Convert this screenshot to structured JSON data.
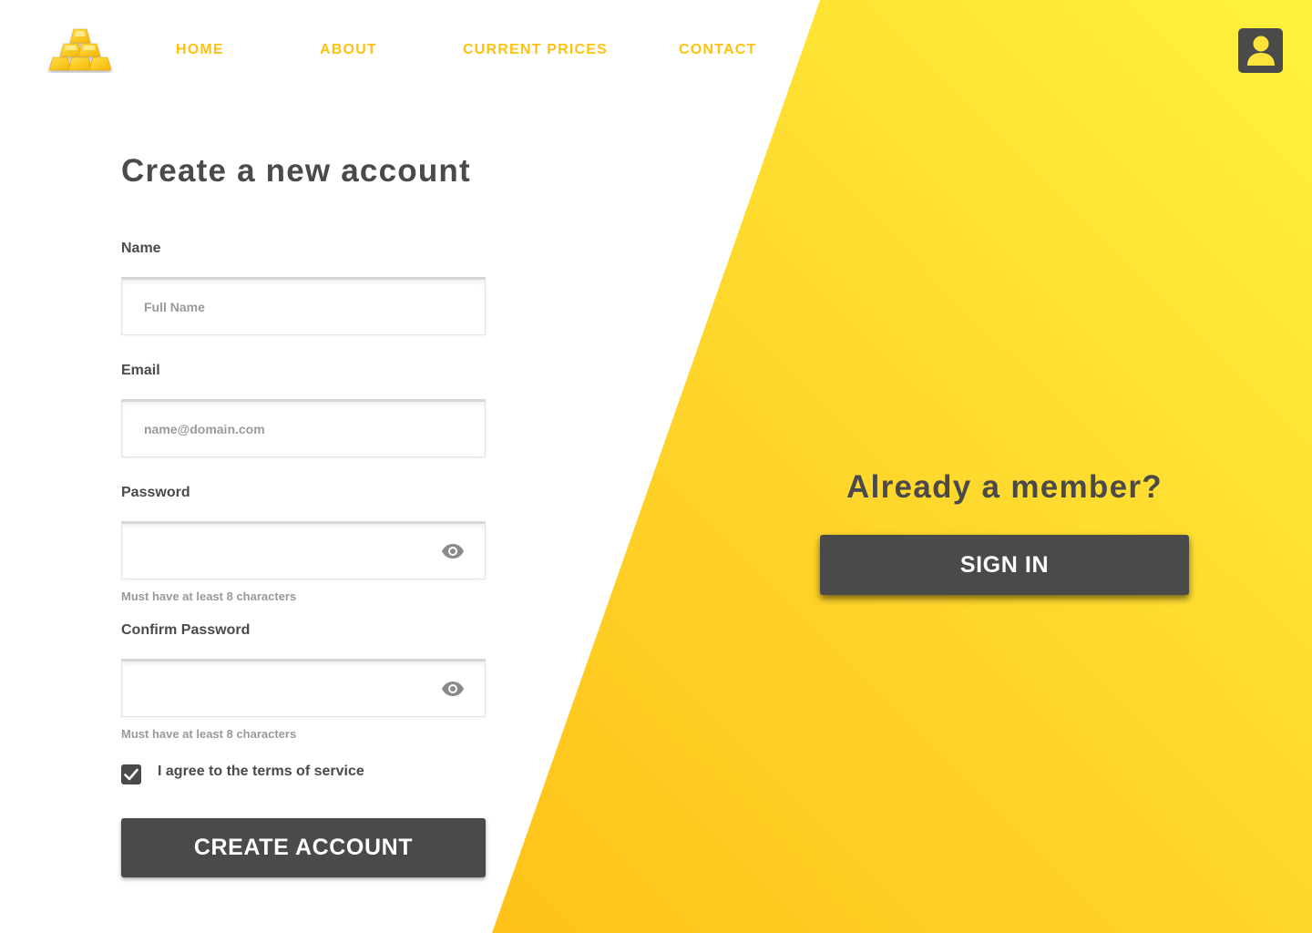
{
  "nav": {
    "links": [
      "HOME",
      "ABOUT",
      "CURRENT PRICES",
      "CONTACT"
    ]
  },
  "form": {
    "title": "Create a new account",
    "name_label": "Name",
    "name_placeholder": "Full Name",
    "email_label": "Email",
    "email_placeholder": "name@domain.com",
    "password_label": "Password",
    "password_hint": "Must have at least 8 characters",
    "confirm_label": "Confirm Password",
    "confirm_hint": "Must have at least 8 characters",
    "terms_checked": true,
    "terms_label": "I agree to the terms of service",
    "submit_label": "CREATE ACCOUNT"
  },
  "member": {
    "title": "Already a member?",
    "signin_label": "SIGN IN"
  },
  "icons": {
    "logo": "gold-bars-logo-icon",
    "account": "user-account-icon",
    "password_toggle": "eye-icon",
    "checkbox": "checkmark-icon"
  },
  "colors": {
    "accent": "#ffc20e",
    "dark": "#4a4a4a",
    "panel_light": "#fff23e",
    "panel_dark": "#ffb70f",
    "hint": "#9a9a9a"
  }
}
